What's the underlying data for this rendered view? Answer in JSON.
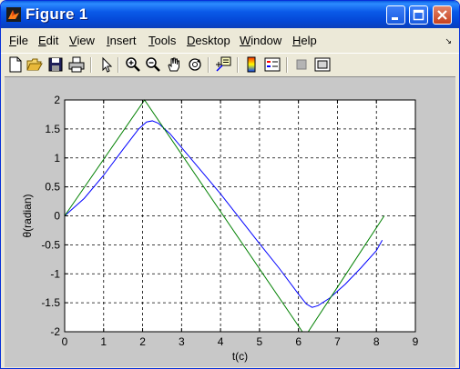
{
  "window": {
    "title": "Figure 1"
  },
  "menu": {
    "items": [
      {
        "label": "File",
        "accel": "F",
        "rest": "ile"
      },
      {
        "label": "Edit",
        "accel": "E",
        "rest": "dit"
      },
      {
        "label": "View",
        "accel": "V",
        "rest": "iew"
      },
      {
        "label": "Insert",
        "accel": "I",
        "rest": "nsert"
      },
      {
        "label": "Tools",
        "accel": "T",
        "rest": "ools"
      },
      {
        "label": "Desktop",
        "accel": "D",
        "rest": "esktop"
      },
      {
        "label": "Window",
        "accel": "W",
        "rest": "indow"
      },
      {
        "label": "Help",
        "accel": "H",
        "rest": "elp"
      }
    ],
    "overflow_arrow": "↘"
  },
  "toolbar": {
    "icons": [
      "new-figure-icon",
      "open-file-icon",
      "save-icon",
      "print-icon",
      "edit-plot-arrow-icon",
      "zoom-in-icon",
      "zoom-out-icon",
      "pan-hand-icon",
      "rotate-3d-icon",
      "data-cursor-icon",
      "colorbar-icon",
      "legend-icon",
      "hide-plot-tools-icon",
      "show-plot-tools-icon"
    ]
  },
  "chart_data": {
    "type": "line",
    "title": "",
    "xlabel": "t(c)",
    "ylabel": "θ(radian)",
    "xlim": [
      0,
      9
    ],
    "ylim": [
      -2,
      2
    ],
    "xticks": [
      0,
      1,
      2,
      3,
      4,
      5,
      6,
      7,
      8,
      9
    ],
    "yticks": [
      -2,
      -1.5,
      -1,
      -0.5,
      0,
      0.5,
      1,
      1.5,
      2
    ],
    "ytick_labels": [
      "-2",
      "-1.5",
      "-1",
      "-0.5",
      "0",
      "0.5",
      "1",
      "1.5",
      "2"
    ],
    "grid": true,
    "series": [
      {
        "color": "#0000ff",
        "x": [
          0,
          0.5,
          1.0,
          1.5,
          1.9,
          2.1,
          2.25,
          2.4,
          2.7,
          3.0,
          3.5,
          4.0,
          4.5,
          5.0,
          5.5,
          6.0,
          6.2,
          6.35,
          6.5,
          6.8,
          7.2,
          7.6,
          8.0,
          8.15
        ],
        "y": [
          0,
          0.3,
          0.7,
          1.15,
          1.5,
          1.62,
          1.64,
          1.6,
          1.42,
          1.18,
          0.78,
          0.38,
          -0.05,
          -0.48,
          -0.9,
          -1.35,
          -1.52,
          -1.58,
          -1.55,
          -1.42,
          -1.18,
          -0.9,
          -0.6,
          -0.42
        ]
      },
      {
        "color": "#008000",
        "x": [
          0,
          2.05,
          6.1,
          6.25,
          8.2
        ],
        "y": [
          0,
          2.0,
          -2.0,
          -2.0,
          0
        ]
      }
    ]
  }
}
